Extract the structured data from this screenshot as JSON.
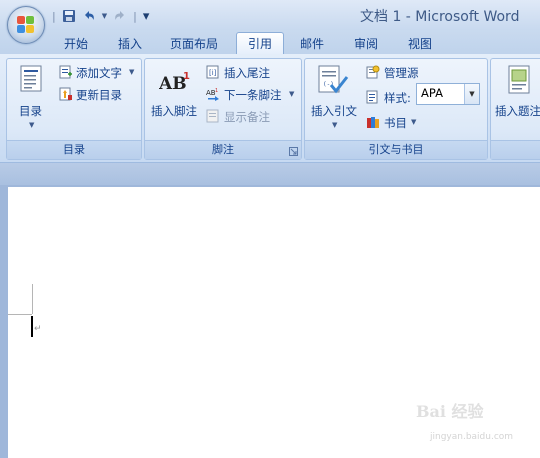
{
  "window": {
    "title": "文档 1 - Microsoft Word"
  },
  "quick_access": {
    "save_icon": "save-icon",
    "undo_icon": "undo-icon",
    "redo_icon": "redo-icon",
    "customize_glyph": "▾"
  },
  "tabs": [
    "开始",
    "插入",
    "页面布局",
    "引用",
    "邮件",
    "审阅",
    "视图"
  ],
  "active_tab": "引用",
  "ribbon": {
    "toc": {
      "toc_button": "目录",
      "add_text": "添加文字",
      "update_toc": "更新目录",
      "group_label": "目录"
    },
    "footnotes": {
      "insert_footnote": "插入脚注",
      "insert_endnote": "插入尾注",
      "next_footnote": "下一条脚注",
      "show_notes": "显示备注",
      "group_label": "脚注"
    },
    "citations": {
      "insert_citation": "插入引文",
      "manage_sources": "管理源",
      "style_label": "样式:",
      "style_value": "APA",
      "bibliography": "书目",
      "group_label": "引文与书目"
    },
    "captions": {
      "insert_caption": "插入题注"
    }
  },
  "colors": {
    "ribbon_text": "#15428b",
    "ribbon_bg": "#d4e3f6",
    "doc_bg": "#9fb7da"
  },
  "watermark": {
    "brand": "Bai 经验",
    "url": "jingyan.baidu.com"
  }
}
